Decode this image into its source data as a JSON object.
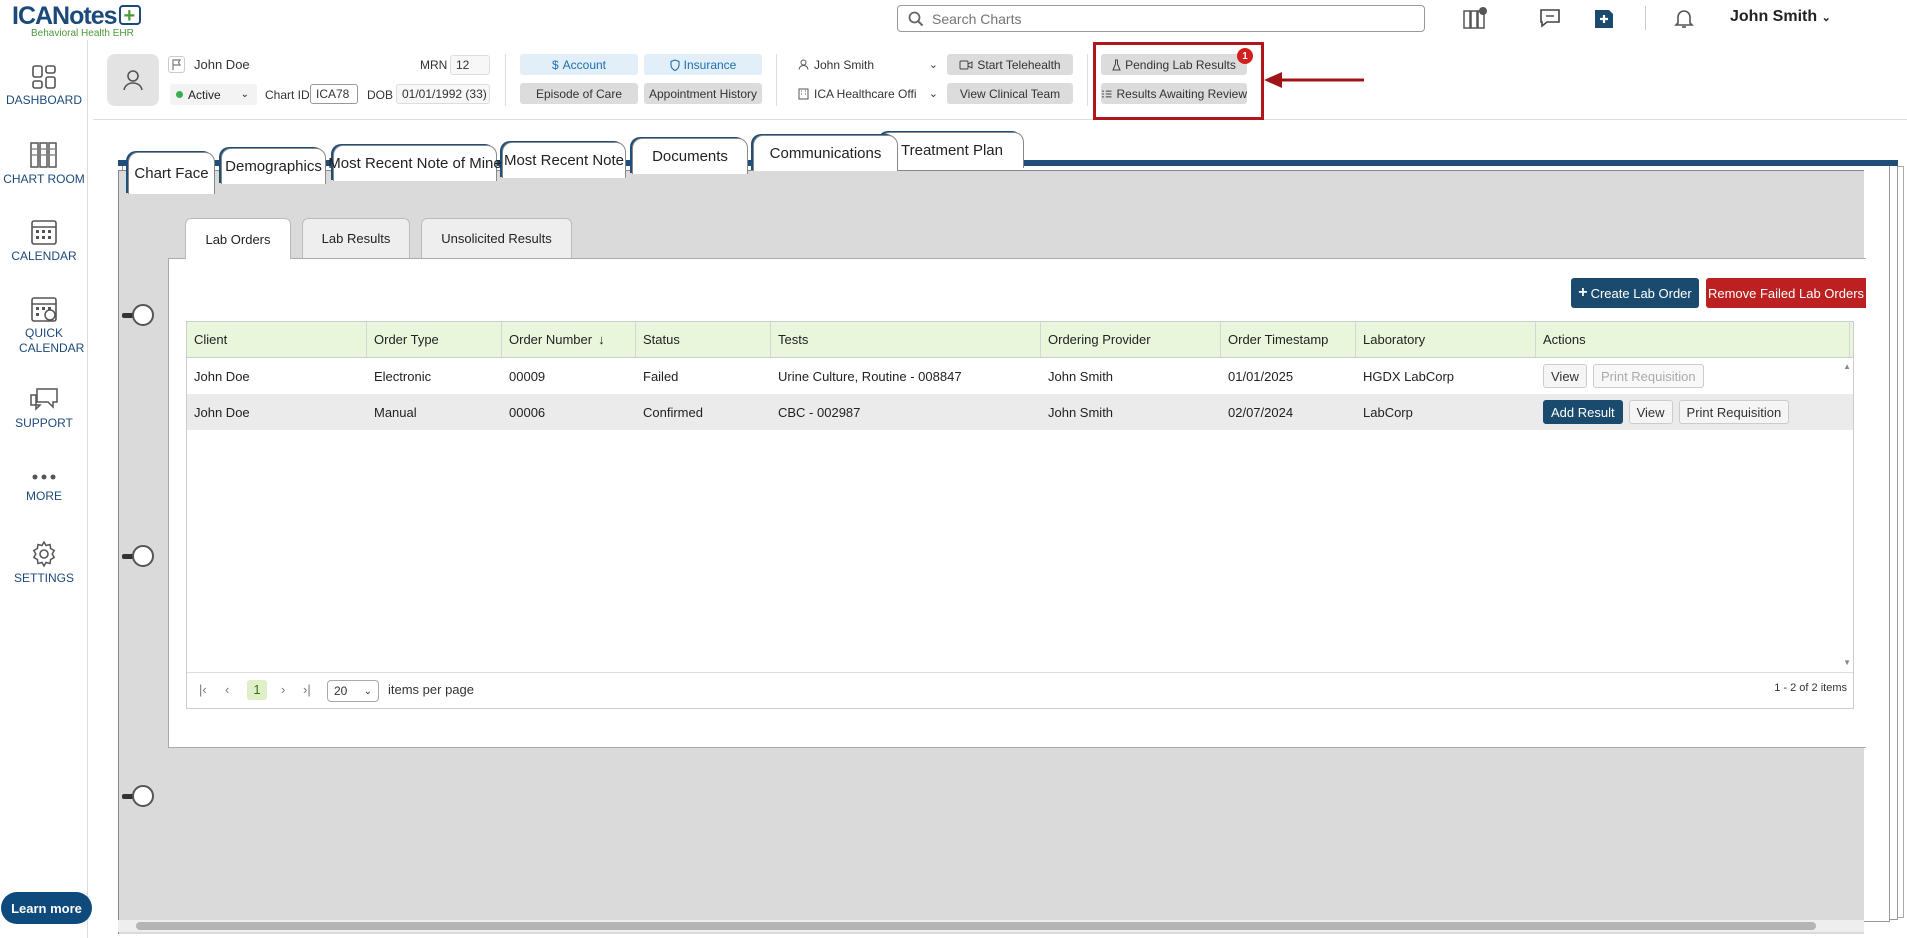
{
  "app": {
    "brand_main": "ICANotes",
    "brand_sub": "Behavioral Health EHR"
  },
  "search": {
    "placeholder": "Search Charts"
  },
  "user": {
    "name": "John Smith"
  },
  "sidebar": {
    "items": [
      {
        "label": "DASHBOARD"
      },
      {
        "label": "CHART ROOM"
      },
      {
        "label": "CALENDAR"
      },
      {
        "label": "QUICK CALENDAR"
      },
      {
        "label": "SUPPORT"
      },
      {
        "label": "MORE"
      },
      {
        "label": "SETTINGS"
      }
    ],
    "learn_more": "Learn more"
  },
  "patient": {
    "name": "John Doe",
    "mrn_label": "MRN",
    "mrn": "12",
    "status": "Active",
    "chart_id_label": "Chart ID",
    "chart_id": "ICA78",
    "dob_label": "DOB",
    "dob": "01/01/1992 (33)"
  },
  "header_buttons": {
    "account": "Account",
    "insurance": "Insurance",
    "episode": "Episode of Care",
    "appointment_history": "Appointment History",
    "provider": "John Smith",
    "office": "ICA Healthcare Offi",
    "telehealth": "Start Telehealth",
    "clinical_team": "View Clinical Team",
    "pending_lab": "Pending Lab Results",
    "pending_lab_count": "1",
    "awaiting_review": "Results Awaiting Review"
  },
  "tabs": [
    "Chart Face",
    "Demographics",
    "Most Recent Note of Mine",
    "Most Recent Note",
    "Documents",
    "Communications",
    "Treatment Plan"
  ],
  "subtabs": [
    "Lab Orders",
    "Lab Results",
    "Unsolicited Results"
  ],
  "actions": {
    "create": "Create Lab Order",
    "remove": "Remove Failed Lab Orders"
  },
  "table": {
    "columns": [
      "Client",
      "Order Type",
      "Order Number",
      "Status",
      "Tests",
      "Ordering Provider",
      "Order Timestamp",
      "Laboratory",
      "Actions"
    ],
    "rows": [
      {
        "client": "John Doe",
        "order_type": "Electronic",
        "order_number": "00009",
        "status": "Failed",
        "tests": "Urine Culture, Routine - 008847",
        "provider": "John Smith",
        "timestamp": "01/01/2025",
        "laboratory": "HGDX LabCorp",
        "actions": [
          "View",
          "Print Requisition"
        ]
      },
      {
        "client": "John Doe",
        "order_type": "Manual",
        "order_number": "00006",
        "status": "Confirmed",
        "tests": "CBC - 002987",
        "provider": "John Smith",
        "timestamp": "02/07/2024",
        "laboratory": "LabCorp",
        "actions": [
          "Add Result",
          "View",
          "Print Requisition"
        ]
      }
    ]
  },
  "pager": {
    "current_page": "1",
    "page_size": "20",
    "per_page_label": "items per page",
    "summary": "1 - 2 of 2 items"
  }
}
